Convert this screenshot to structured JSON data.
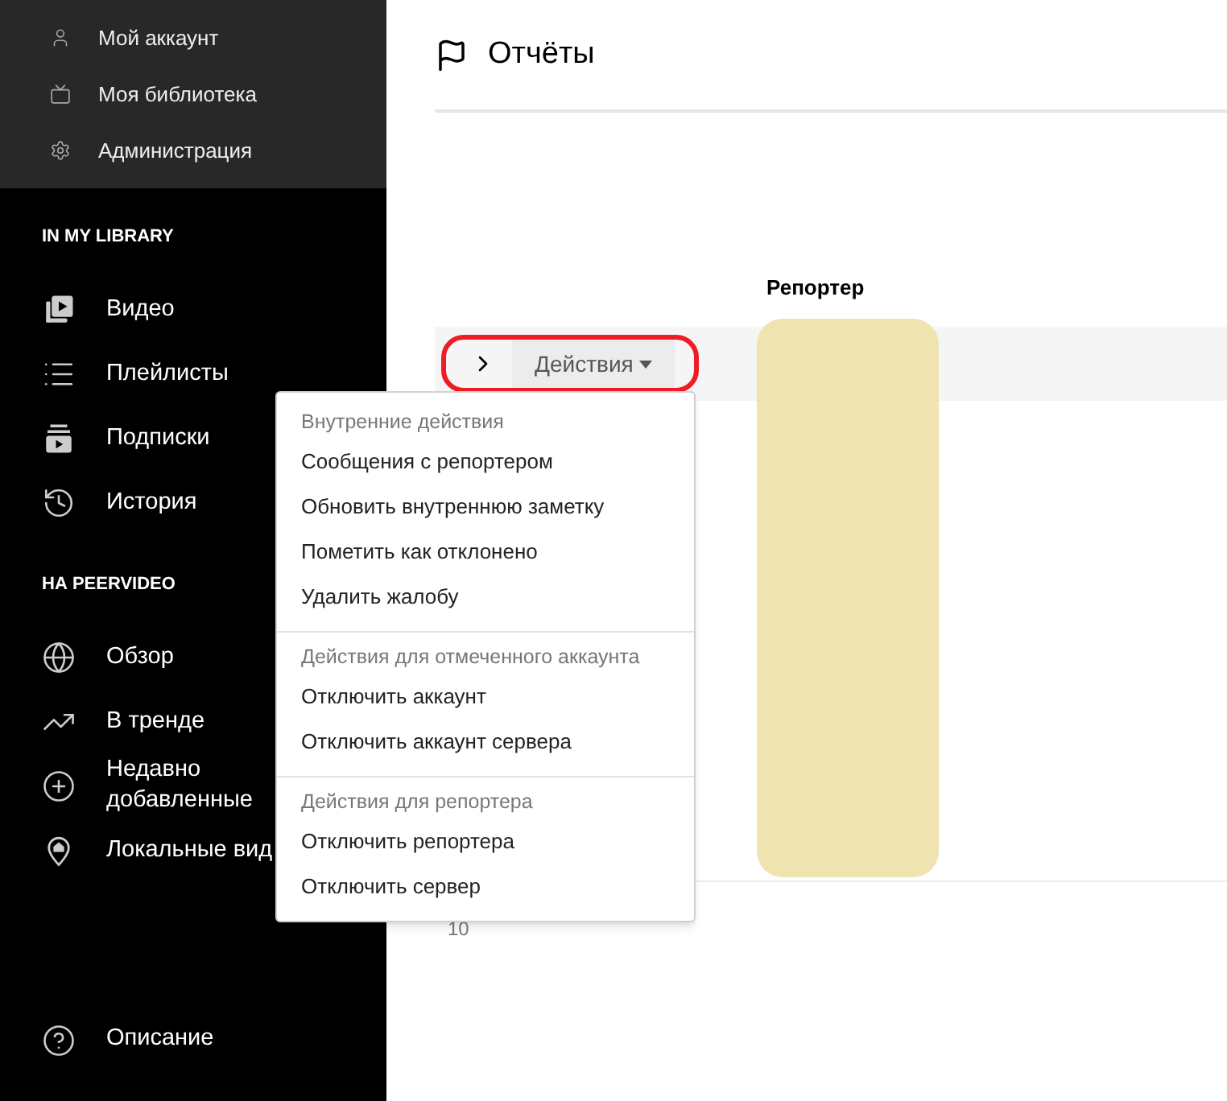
{
  "sidebar": {
    "top_items": [
      "Мой аккаунт",
      "Моя библиотека",
      "Администрация"
    ],
    "sections": [
      {
        "heading": "IN MY LIBRARY",
        "items": [
          "Видео",
          "Плейлисты",
          "Подписки",
          "История"
        ]
      },
      {
        "heading": "НА PEERVIDEO",
        "items": [
          "Обзор",
          "В тренде",
          "Недавно добавленные",
          "Локальные вид"
        ]
      }
    ],
    "bottom_items": [
      "Описание"
    ]
  },
  "page": {
    "title": "Отчёты"
  },
  "table": {
    "columns": [
      "Репортер"
    ],
    "row": {
      "expanded": false,
      "actions_button": "Действия"
    },
    "footer": "10"
  },
  "actions_menu": {
    "groups": [
      {
        "heading": "Внутренние действия",
        "items": [
          "Сообщения с репортером",
          "Обновить внутреннюю заметку",
          "Пометить как отклонено",
          "Удалить жалобу"
        ]
      },
      {
        "heading": "Действия для отмеченного аккаунта",
        "items": [
          "Отключить аккаунт",
          "Отключить аккаунт сервера"
        ]
      },
      {
        "heading": "Действия для репортера",
        "items": [
          "Отключить репортера",
          "Отключить сервер"
        ]
      }
    ]
  }
}
